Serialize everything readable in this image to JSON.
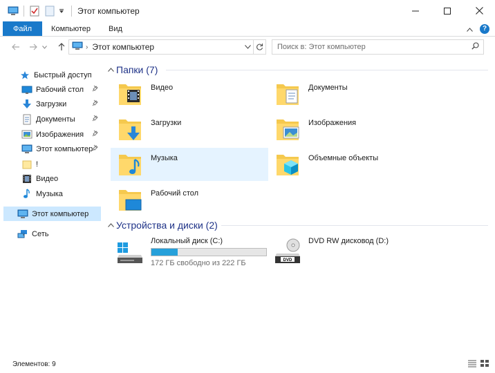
{
  "window": {
    "title": "Этот компьютер",
    "controls": [
      "minimize",
      "maximize",
      "close"
    ]
  },
  "ribbon": {
    "tabs": [
      "Файл",
      "Компьютер",
      "Вид"
    ],
    "active_tab": "Файл",
    "accent_color": "#1979ca"
  },
  "address": {
    "path": "Этот компьютер",
    "search_placeholder": "Поиск в: Этот компьютер"
  },
  "sidebar": {
    "items": [
      {
        "label": "Быстрый доступ",
        "icon": "star-icon"
      },
      {
        "label": "Рабочий стол",
        "icon": "desktop-icon",
        "pinned": true
      },
      {
        "label": "Загрузки",
        "icon": "download-arrow-icon",
        "pinned": true
      },
      {
        "label": "Документы",
        "icon": "documents-icon",
        "pinned": true
      },
      {
        "label": "Изображения",
        "icon": "pictures-icon",
        "pinned": true
      },
      {
        "label": "Этот компьютер",
        "icon": "computer-icon",
        "pinned": true
      },
      {
        "label": "!",
        "icon": "folder-icon"
      },
      {
        "label": "Видео",
        "icon": "video-icon"
      },
      {
        "label": "Музыка",
        "icon": "music-icon"
      },
      {
        "label": "Этот компьютер",
        "icon": "computer-icon",
        "selected": true
      },
      {
        "label": "Сеть",
        "icon": "network-icon"
      }
    ]
  },
  "main": {
    "folders_header": "Папки (7)",
    "folders": [
      {
        "label": "Видео",
        "icon": "video-folder-icon"
      },
      {
        "label": "Документы",
        "icon": "documents-folder-icon"
      },
      {
        "label": "Загрузки",
        "icon": "downloads-folder-icon"
      },
      {
        "label": "Изображения",
        "icon": "pictures-folder-icon"
      },
      {
        "label": "Музыка",
        "icon": "music-folder-icon",
        "hovered": true
      },
      {
        "label": "Объемные объекты",
        "icon": "3d-objects-folder-icon"
      },
      {
        "label": "Рабочий стол",
        "icon": "desktop-folder-icon"
      }
    ],
    "devices_header": "Устройства и диски (2)",
    "devices": [
      {
        "label": "Локальный диск (C:)",
        "free_text": "172 ГБ свободно из 222 ГБ",
        "used_fraction": 0.23,
        "icon": "windows-drive-icon"
      },
      {
        "label": "DVD RW дисковод (D:)",
        "icon": "dvd-drive-icon"
      }
    ]
  },
  "status": {
    "items_count": "Элементов: 9"
  }
}
